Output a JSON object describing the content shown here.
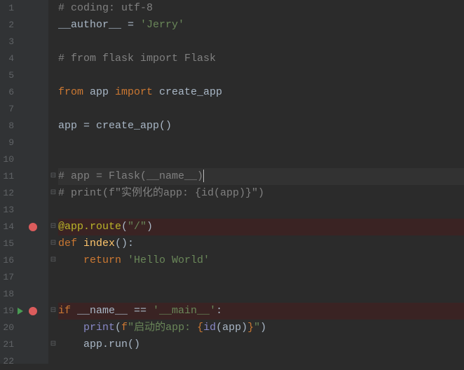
{
  "lines": [
    {
      "n": 1,
      "tokens": [
        [
          "c-comment",
          "# coding: utf-8"
        ]
      ]
    },
    {
      "n": 2,
      "tokens": [
        [
          "c-default",
          "__author__ "
        ],
        [
          "c-default",
          "= "
        ],
        [
          "c-string",
          "'Jerry'"
        ]
      ]
    },
    {
      "n": 3,
      "tokens": []
    },
    {
      "n": 4,
      "tokens": [
        [
          "c-comment",
          "# from flask import Flask"
        ]
      ]
    },
    {
      "n": 5,
      "tokens": []
    },
    {
      "n": 6,
      "tokens": [
        [
          "c-keyword",
          "from "
        ],
        [
          "c-default",
          "app "
        ],
        [
          "c-keyword",
          "import "
        ],
        [
          "c-default",
          "create_app"
        ]
      ]
    },
    {
      "n": 7,
      "tokens": []
    },
    {
      "n": 8,
      "tokens": [
        [
          "c-default",
          "app = create_app()"
        ]
      ]
    },
    {
      "n": 9,
      "tokens": []
    },
    {
      "n": 10,
      "tokens": []
    },
    {
      "n": 11,
      "current": true,
      "fold": "open",
      "tokens": [
        [
          "c-comment",
          "# app = Flask(__name__)"
        ]
      ],
      "cursor": true
    },
    {
      "n": 12,
      "fold": "close",
      "tokens": [
        [
          "c-comment",
          "# print(f\"实例化的app: {id(app)}\")"
        ]
      ]
    },
    {
      "n": 13,
      "tokens": []
    },
    {
      "n": 14,
      "bp": true,
      "fold": "open",
      "tokens": [
        [
          "c-decor",
          "@app.route"
        ],
        [
          "c-default",
          "("
        ],
        [
          "c-string",
          "\"/\""
        ],
        [
          "c-default",
          ")"
        ]
      ]
    },
    {
      "n": 15,
      "fold": "open",
      "tokens": [
        [
          "c-keyword",
          "def "
        ],
        [
          "c-func",
          "index"
        ],
        [
          "c-default",
          "():"
        ]
      ]
    },
    {
      "n": 16,
      "fold": "close",
      "tokens": [
        [
          "c-default",
          "    "
        ],
        [
          "c-keyword",
          "return "
        ],
        [
          "c-string",
          "'Hello World'"
        ]
      ]
    },
    {
      "n": 17,
      "tokens": []
    },
    {
      "n": 18,
      "tokens": []
    },
    {
      "n": 19,
      "bp": true,
      "run": true,
      "fold": "open",
      "tokens": [
        [
          "c-keyword",
          "if "
        ],
        [
          "c-default",
          "__name__ == "
        ],
        [
          "c-string",
          "'__main__'"
        ],
        [
          "c-default",
          ":"
        ]
      ]
    },
    {
      "n": 20,
      "tokens": [
        [
          "c-default",
          "    "
        ],
        [
          "c-builtin",
          "print"
        ],
        [
          "c-default",
          "("
        ],
        [
          "c-keyword",
          "f"
        ],
        [
          "c-string",
          "\"启动的app: "
        ],
        [
          "c-fstring-brace",
          "{"
        ],
        [
          "c-builtin",
          "id"
        ],
        [
          "c-default",
          "(app)"
        ],
        [
          "c-fstring-brace",
          "}"
        ],
        [
          "c-string",
          "\""
        ],
        [
          "c-default",
          ")"
        ]
      ]
    },
    {
      "n": 21,
      "fold": "close",
      "tokens": [
        [
          "c-default",
          "    app.run()"
        ]
      ]
    },
    {
      "n": 22,
      "tokens": []
    }
  ],
  "fold_glyphs": {
    "open": "⊟",
    "close": "⊟"
  }
}
